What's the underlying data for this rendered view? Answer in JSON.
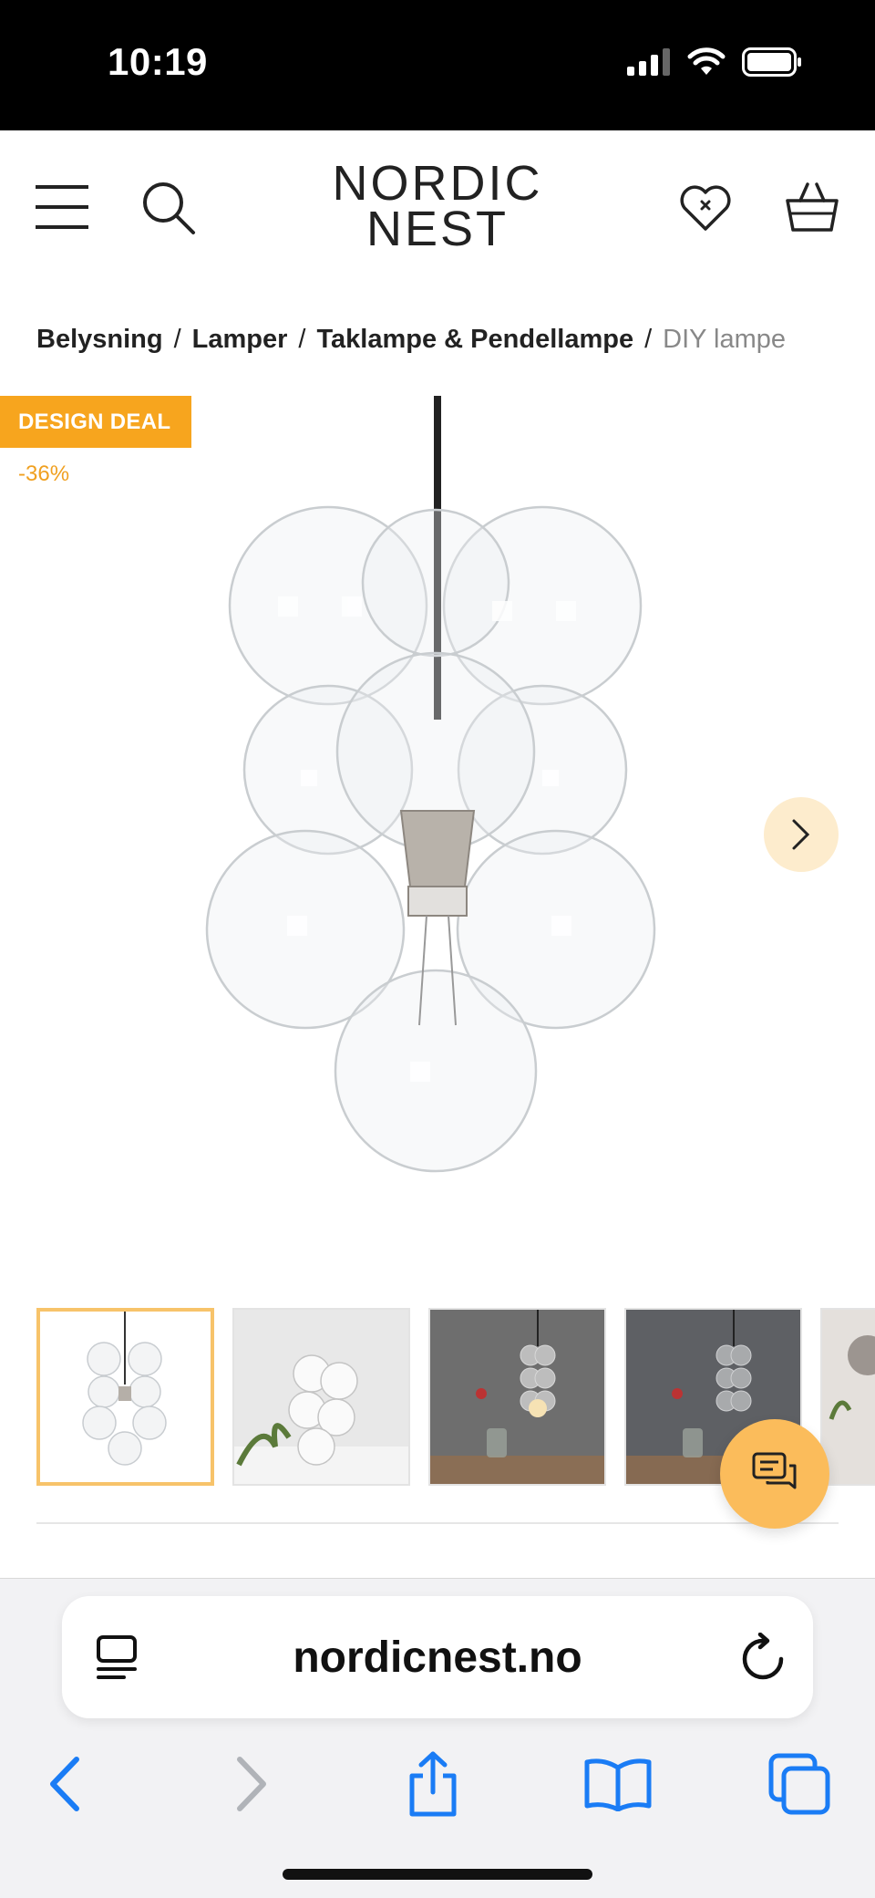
{
  "status_bar": {
    "time": "10:19"
  },
  "header": {
    "logo_line1": "NORDIC",
    "logo_line2": "NEST"
  },
  "breadcrumb": {
    "items": [
      "Belysning",
      "Lamper",
      "Taklampe & Pendellampe"
    ],
    "separator": "/",
    "current": "DIY lampe"
  },
  "product": {
    "badge": "DESIGN DEAL",
    "discount": "-36%",
    "accent_color": "#f7a51e",
    "thumbnails_count": 5,
    "selected_thumbnail": 1
  },
  "browser": {
    "url": "nordicnest.no"
  },
  "icons": {
    "menu": "hamburger-icon",
    "search": "search-icon",
    "wishlist": "heart-icon",
    "cart": "basket-icon",
    "chat": "chat-icon",
    "next": "chevron-right-icon"
  }
}
